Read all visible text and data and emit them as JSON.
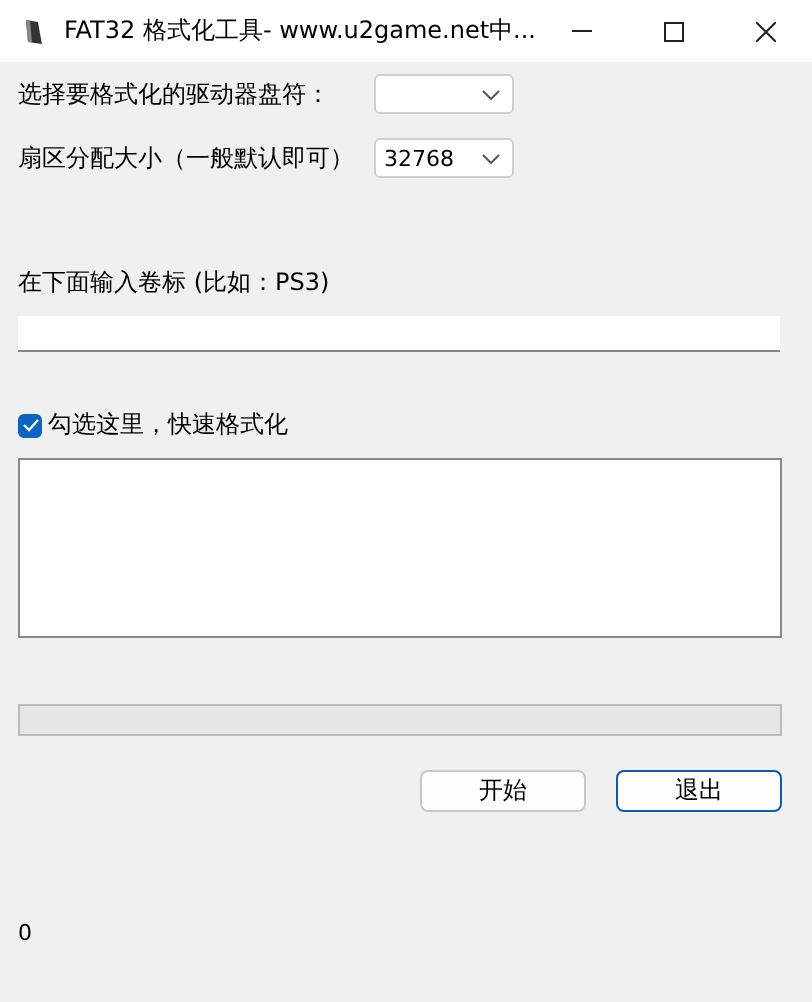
{
  "window": {
    "title": "FAT32 格式化工具- www.u2game.net中..."
  },
  "drive": {
    "label": "选择要格式化的驱动器盘符："
  },
  "cluster": {
    "label": "扇区分配大小（一般默认即可）",
    "value": "32768"
  },
  "volume": {
    "label": "在下面输入卷标 (比如：PS3)"
  },
  "quick_format": {
    "label": "勾选这里，快速格式化",
    "checked": true
  },
  "progress": {
    "level": 0
  },
  "buttons": [
    {
      "label": "开始",
      "focused": false
    },
    {
      "label": "退出",
      "focused": true
    }
  ],
  "status_bar": "0"
}
